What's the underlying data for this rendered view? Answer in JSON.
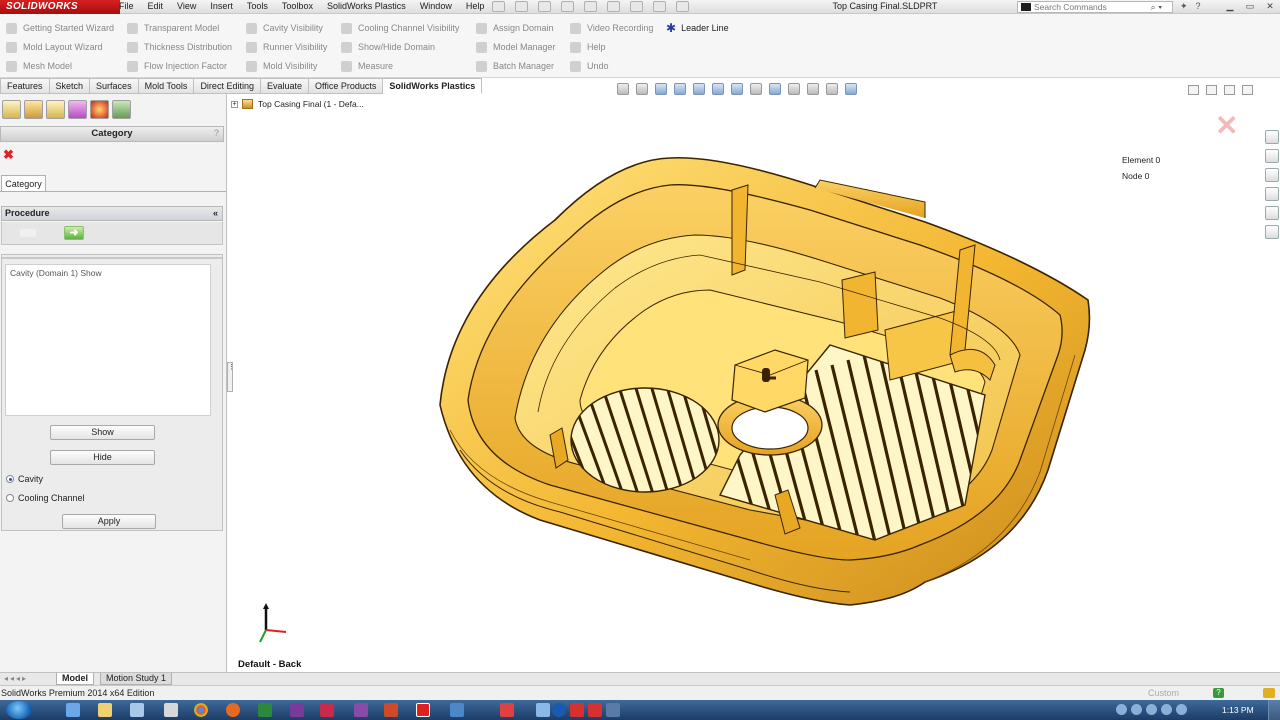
{
  "app": {
    "logo": "SOLIDWORKS",
    "menu": [
      "File",
      "Edit",
      "View",
      "Insert",
      "Tools",
      "Toolbox",
      "SolidWorks Plastics",
      "Window",
      "Help"
    ],
    "document_title": "Top Casing Final.SLDPRT",
    "search_placeholder": "Search Commands"
  },
  "plastics_toolbar": {
    "col1": [
      "Getting Started Wizard",
      "Mold Layout Wizard",
      "Mesh Model"
    ],
    "col2": [
      "Transparent Model",
      "Thickness Distribution",
      "Flow Injection Factor"
    ],
    "col3": [
      "Cavity Visibility",
      "Runner Visibility",
      "Mold Visibility"
    ],
    "col4": [
      "Cooling Channel Visibility",
      "Show/Hide Domain",
      "Measure"
    ],
    "col5": [
      "Assign Domain",
      "Model Manager",
      "Batch Manager"
    ],
    "col6": [
      "Video Recording",
      "Help",
      "Undo"
    ],
    "col7": [
      "Leader Line"
    ]
  },
  "command_tabs": [
    "Features",
    "Sketch",
    "Surfaces",
    "Mold Tools",
    "Direct Editing",
    "Evaluate",
    "Office Products",
    "SolidWorks Plastics"
  ],
  "active_tab": "SolidWorks Plastics",
  "panel": {
    "title": "Category",
    "help": "?",
    "close_icon": "✖",
    "category_tab": "Category",
    "procedure_label": "Procedure",
    "procedure_collapse": "«",
    "procedure_next": "➜",
    "list_item": "Cavity (Domain 1) Show",
    "show_label": "Show",
    "hide_label": "Hide",
    "radio_cavity": "Cavity",
    "radio_cooling": "Cooling Channel",
    "selected_radio": "Cavity",
    "apply_label": "Apply"
  },
  "graphics": {
    "tree_label": "Top Casing Final  (1 - Defa...",
    "element_count": "Element 0",
    "node_count": "Node 0",
    "view_label": "Default - Back",
    "part_color": "#f2b531"
  },
  "bottom_tabs": [
    "Model",
    "Motion Study 1"
  ],
  "status_left": "SolidWorks Premium 2014 x64 Edition",
  "status_custom": "Custom",
  "clock": "1:13 PM"
}
